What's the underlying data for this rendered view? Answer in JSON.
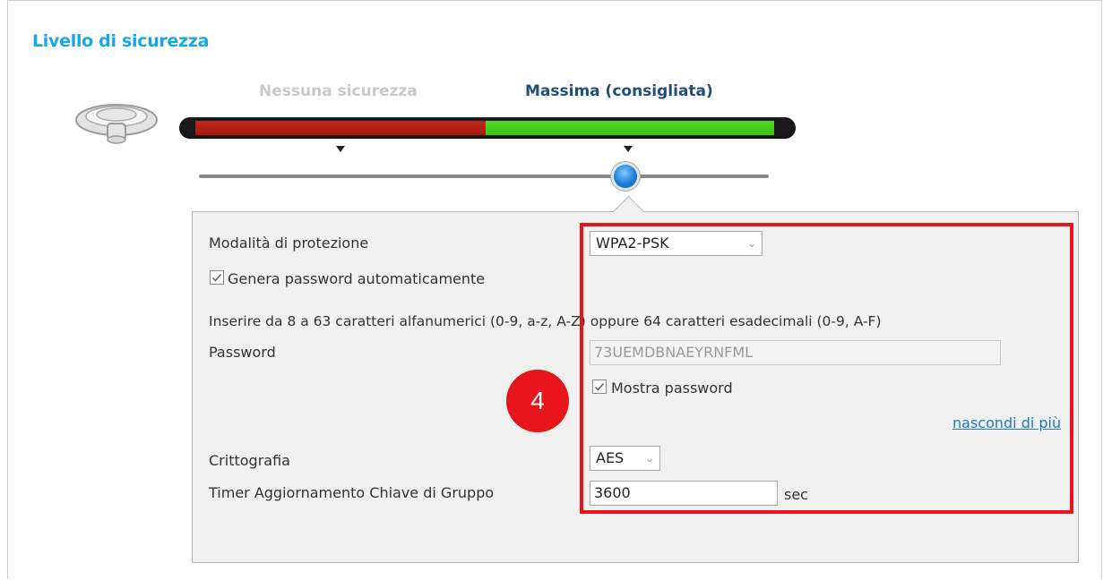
{
  "section": {
    "title": "Livello di sicurezza"
  },
  "security_level": {
    "label_none": "Nessuna sicurezza",
    "label_max": "Massima (consigliata)",
    "selected": "Massima (consigliata)",
    "slider_value": 1.0,
    "colors": {
      "low": "#b31f14",
      "high": "#46cf20",
      "knob": "#1778d8"
    }
  },
  "form": {
    "protection_mode_label": "Modalità di protezione",
    "protection_mode_value": "WPA2-PSK",
    "auto_password_label": "Genera password automaticamente",
    "auto_password_checked": true,
    "hint": "Inserire da 8 a 63 caratteri alfanumerici (0-9, a-z, A-Z) oppure 64 caratteri esadecimali (0-9, A-F)",
    "password_label": "Password",
    "password_value": "73UEMDBNAEYRNFML",
    "show_password_label": "Mostra password",
    "show_password_checked": true,
    "less_link": "nascondi di più",
    "encryption_label": "Crittografia",
    "encryption_value": "AES",
    "group_key_timer_label": "Timer Aggiornamento Chiave di Gruppo",
    "group_key_timer_value": "3600",
    "group_key_timer_unit": "sec"
  },
  "annotation": {
    "step_number": "4",
    "color": "#e8141b"
  },
  "icons": {
    "wifi": "wifi-router-icon",
    "dropdown": "chevron-down-icon",
    "check": "checkmark-icon"
  }
}
